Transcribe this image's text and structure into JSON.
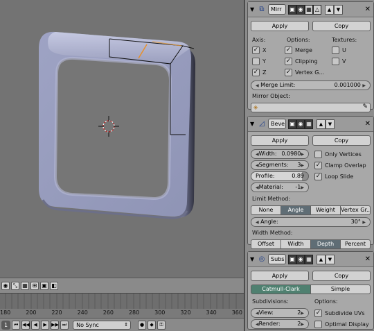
{
  "timeline": {
    "ticks": [
      "180",
      "200",
      "220",
      "240",
      "260",
      "280",
      "300",
      "320",
      "340",
      "360"
    ]
  },
  "footer": {
    "frame": "1",
    "sync": "No Sync"
  },
  "mirror": {
    "name": "Mirr",
    "apply": "Apply",
    "copy": "Copy",
    "axis_label": "Axis:",
    "options_label": "Options:",
    "textures_label": "Textures:",
    "x": "X",
    "y": "Y",
    "z": "Z",
    "merge": "Merge",
    "clipping": "Clipping",
    "vertex_groups": "Vertex G...",
    "u": "U",
    "v": "V",
    "merge_limit_label": "Merge Limit:",
    "merge_limit_value": "0.001000",
    "mirror_object_label": "Mirror Object:"
  },
  "bevel": {
    "name": "Beve",
    "apply": "Apply",
    "copy": "Copy",
    "width_label": "Width:",
    "width_value": "0.0980",
    "segments_label": "Segments:",
    "segments_value": "3",
    "profile_label": "Profile:",
    "profile_value": "0.89",
    "material_label": "Material:",
    "material_value": "-1",
    "only_vertices": "Only Vertices",
    "clamp_overlap": "Clamp Overlap",
    "loop_slide": "Loop Slide",
    "limit_method_label": "Limit Method:",
    "limit_methods": [
      "None",
      "Angle",
      "Weight",
      "Vertex Gr..."
    ],
    "angle_label": "Angle:",
    "angle_value": "30°",
    "width_method_label": "Width Method:",
    "width_methods": [
      "Offset",
      "Width",
      "Depth",
      "Percent"
    ]
  },
  "subsurf": {
    "name": "Subs",
    "apply": "Apply",
    "copy": "Copy",
    "types": [
      "Catmull-Clark",
      "Simple"
    ],
    "subdivisions_label": "Subdivisions:",
    "options_label": "Options:",
    "view_label": "View:",
    "view_value": "2",
    "render_label": "Render:",
    "render_value": "2",
    "subdivide_uvs": "Subdivide UVs",
    "optimal_display": "Optimal Display"
  }
}
